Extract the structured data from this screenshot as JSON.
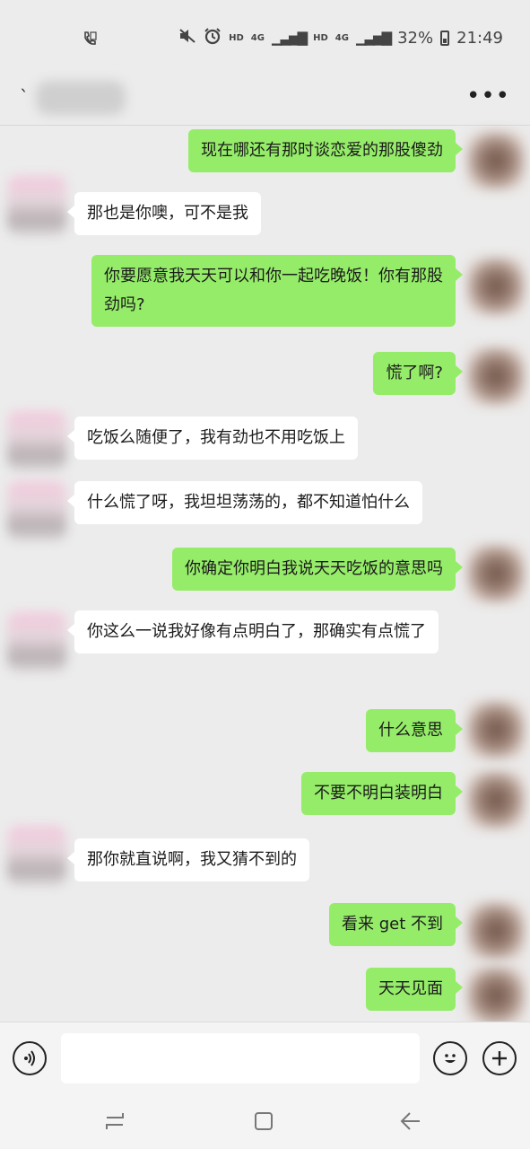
{
  "status_bar": {
    "left_icon": "call-forward-icon",
    "hd1": "HD",
    "net1": "4G",
    "hd2": "HD",
    "net2": "4G",
    "battery_pct": "32%",
    "time": "21:49",
    "icons": [
      "mute-icon",
      "alarm-icon",
      "signal-icon",
      "battery-icon"
    ]
  },
  "header": {
    "back_glyph": "ˋ",
    "more_label": "•••"
  },
  "messages": [
    {
      "side": "right",
      "text": "现在哪还有那时谈恋爱的那股傻劲"
    },
    {
      "side": "left",
      "text": "那也是你噢，可不是我"
    },
    {
      "side": "right",
      "text": "你要愿意我天天可以和你一起吃晚饭！你有那股劲吗?"
    },
    {
      "side": "right",
      "text": "慌了啊?"
    },
    {
      "side": "left",
      "text": "吃饭么随便了，我有劲也不用吃饭上"
    },
    {
      "side": "left",
      "text": "什么慌了呀，我坦坦荡荡的，都不知道怕什么"
    },
    {
      "side": "right",
      "text": "你确定你明白我说天天吃饭的意思吗"
    },
    {
      "side": "left",
      "text": "你这么一说我好像有点明白了，那确实有点慌了"
    },
    {
      "side": "right",
      "text": "什么意思"
    },
    {
      "side": "right",
      "text": "不要不明白装明白"
    },
    {
      "side": "left",
      "text": "那你就直说啊，我又猜不到的"
    },
    {
      "side": "right",
      "text": "看来 get 不到"
    },
    {
      "side": "right",
      "text": "天天见面"
    }
  ],
  "input_bar": {
    "voice_icon": "voice-icon",
    "emoji_icon": "emoji-icon",
    "plus_icon": "plus-icon",
    "input_value": ""
  },
  "nav_bar": {
    "icons": [
      "recent-apps-icon",
      "home-icon",
      "back-icon"
    ]
  },
  "colors": {
    "background": "#ececec",
    "sent_bubble": "#95ec69",
    "received_bubble": "#ffffff"
  }
}
